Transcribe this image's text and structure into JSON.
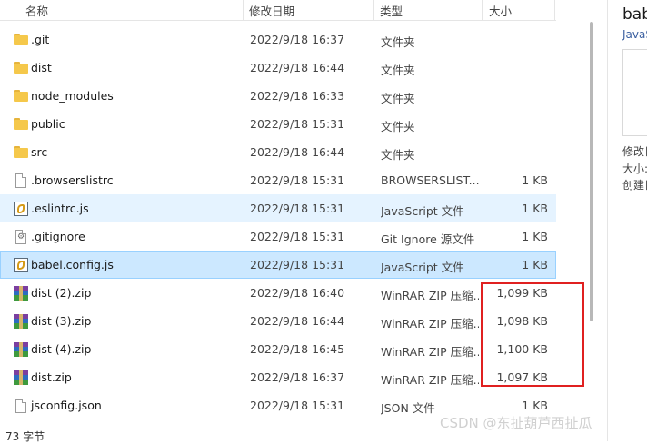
{
  "columns": {
    "name": "名称",
    "modified": "修改日期",
    "type": "类型",
    "size": "大小"
  },
  "files": [
    {
      "name": ".git",
      "date": "2022/9/18 16:37",
      "type": "文件夹",
      "size": "",
      "icon": "folder-icon"
    },
    {
      "name": "dist",
      "date": "2022/9/18 16:44",
      "type": "文件夹",
      "size": "",
      "icon": "folder-icon"
    },
    {
      "name": "node_modules",
      "date": "2022/9/18 16:33",
      "type": "文件夹",
      "size": "",
      "icon": "folder-icon"
    },
    {
      "name": "public",
      "date": "2022/9/18 15:31",
      "type": "文件夹",
      "size": "",
      "icon": "folder-icon"
    },
    {
      "name": "src",
      "date": "2022/9/18 16:44",
      "type": "文件夹",
      "size": "",
      "icon": "folder-icon"
    },
    {
      "name": ".browserslistrc",
      "date": "2022/9/18 15:31",
      "type": "BROWSERSLIST...",
      "size": "1 KB",
      "icon": "file-icon"
    },
    {
      "name": ".eslintrc.js",
      "date": "2022/9/18 15:31",
      "type": "JavaScript 文件",
      "size": "1 KB",
      "icon": "js-file-icon"
    },
    {
      "name": ".gitignore",
      "date": "2022/9/18 15:31",
      "type": "Git Ignore 源文件",
      "size": "1 KB",
      "icon": "settings-file-icon"
    },
    {
      "name": "babel.config.js",
      "date": "2022/9/18 15:31",
      "type": "JavaScript 文件",
      "size": "1 KB",
      "icon": "js-file-icon"
    },
    {
      "name": "dist (2).zip",
      "date": "2022/9/18 16:40",
      "type": "WinRAR ZIP 压缩...",
      "size": "1,099 KB",
      "icon": "winrar-zip-icon"
    },
    {
      "name": "dist (3).zip",
      "date": "2022/9/18 16:44",
      "type": "WinRAR ZIP 压缩...",
      "size": "1,098 KB",
      "icon": "winrar-zip-icon"
    },
    {
      "name": "dist (4).zip",
      "date": "2022/9/18 16:45",
      "type": "WinRAR ZIP 压缩...",
      "size": "1,100 KB",
      "icon": "winrar-zip-icon"
    },
    {
      "name": "dist.zip",
      "date": "2022/9/18 16:37",
      "type": "WinRAR ZIP 压缩...",
      "size": "1,097 KB",
      "icon": "winrar-zip-icon"
    },
    {
      "name": "jsconfig.json",
      "date": "2022/9/18 15:31",
      "type": "JSON 文件",
      "size": "1 KB",
      "icon": "file-icon"
    }
  ],
  "preview": {
    "title": "babel.config.js",
    "subtitle": "JavaScript 文件",
    "modified_label": "修改日期:",
    "size_label": "大小:",
    "created_label": "创建日期:"
  },
  "status": {
    "text": "73 字节"
  },
  "watermark": "CSDN @东扯葫芦西扯瓜",
  "colors": {
    "highlight_border": "#e02020",
    "selected_bg": "#cce8ff",
    "hover_bg": "#e5f3ff"
  }
}
